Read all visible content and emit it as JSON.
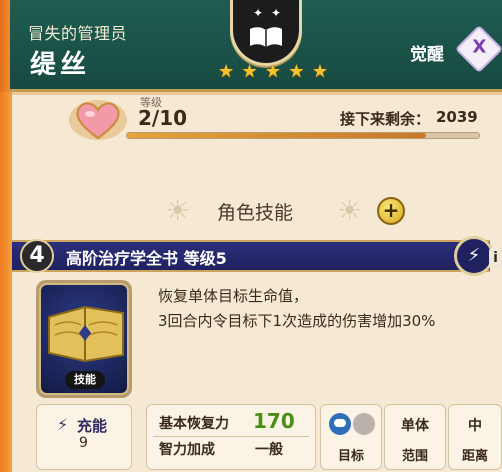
{
  "header": {
    "subtitle": "冒失的管理员",
    "name": "缇丝",
    "star_count": 5,
    "awaken_label": "觉醒",
    "awaken_icon": "awaken-crest-icon",
    "emblem_icon": "book-emblem-icon"
  },
  "level": {
    "title": "等级",
    "value": "2/10",
    "remain_label": "接下来剩余：",
    "remain_value": "2039",
    "exp_fraction": 0.85
  },
  "section": {
    "title": "角色技能"
  },
  "skill": {
    "number": "4",
    "name": "高阶治疗学全书 等级5",
    "card_tag": "技能",
    "description_line1": "恢复单体目标生命值，",
    "description_line2": "3回合内令目标下1次造成的伤害增加30%"
  },
  "stats": {
    "charge_label": "充能",
    "charge_value": "9",
    "base_heal_label": "基本恢复力",
    "base_heal_value": "170",
    "int_bonus_label": "智力加成",
    "int_bonus_value": "一般",
    "target_label": "目标",
    "range_top": "单体",
    "range_label": "范围",
    "distance_top": "中",
    "distance_label": "距离"
  },
  "colors": {
    "header_bg": "#1f5d52",
    "skill_bar_bg": "#2c2f7a",
    "gold": "#f4c431",
    "heal_value": "#4a8d18"
  }
}
